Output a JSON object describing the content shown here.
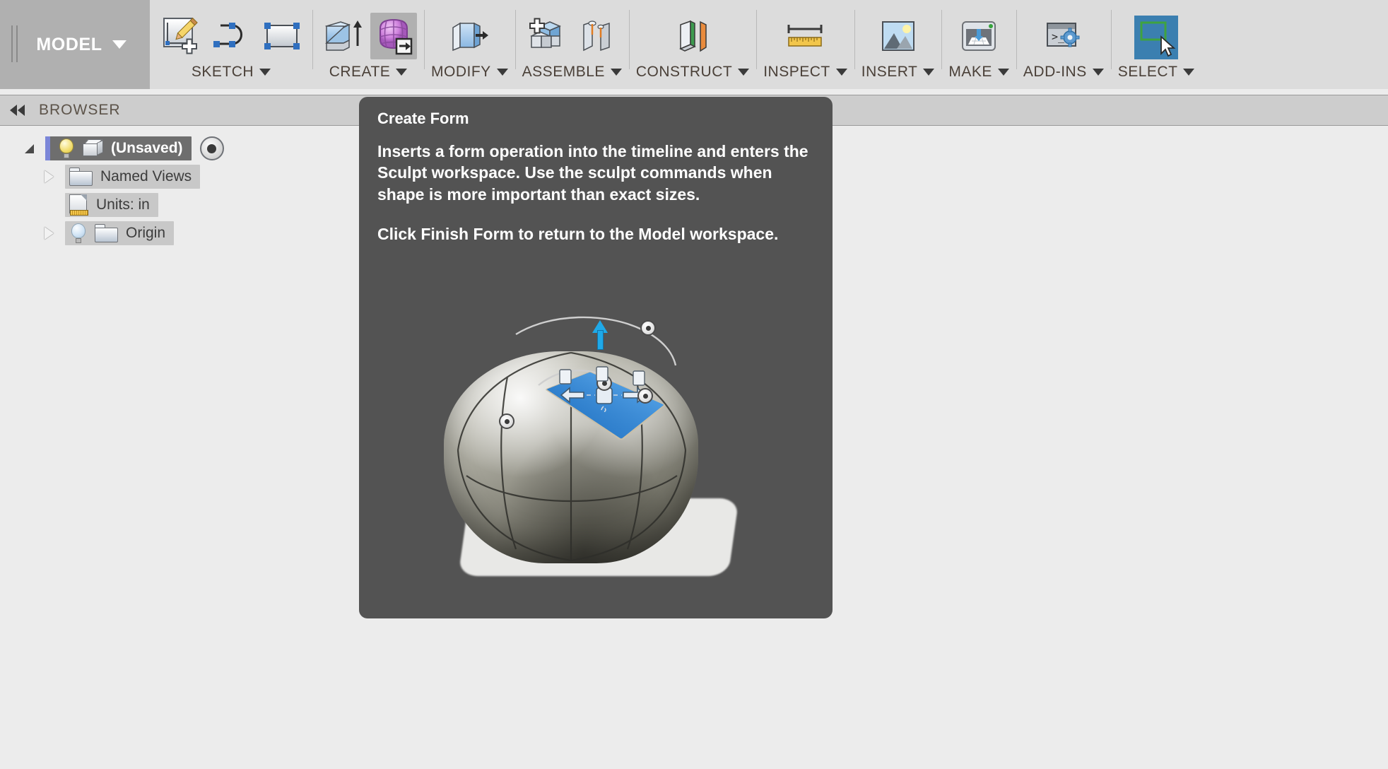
{
  "ribbon": {
    "workspace": {
      "label": "MODEL",
      "icon": "chevron-down-icon"
    },
    "panels": [
      {
        "id": "sketch",
        "label": "SKETCH",
        "tools": [
          {
            "name": "create-sketch-icon",
            "active": false
          },
          {
            "name": "spline-icon",
            "active": false
          },
          {
            "name": "rectangle-icon",
            "active": false
          }
        ]
      },
      {
        "id": "create",
        "label": "CREATE",
        "tools": [
          {
            "name": "extrude-icon",
            "active": false
          },
          {
            "name": "create-form-icon",
            "active": true
          }
        ]
      },
      {
        "id": "modify",
        "label": "MODIFY",
        "tools": [
          {
            "name": "press-pull-icon",
            "active": false
          }
        ]
      },
      {
        "id": "assemble",
        "label": "ASSEMBLE",
        "tools": [
          {
            "name": "new-component-icon",
            "active": false
          },
          {
            "name": "joint-icon",
            "active": false
          }
        ]
      },
      {
        "id": "construct",
        "label": "CONSTRUCT",
        "tools": [
          {
            "name": "offset-plane-icon",
            "active": false
          }
        ]
      },
      {
        "id": "inspect",
        "label": "INSPECT",
        "tools": [
          {
            "name": "measure-icon",
            "active": false
          }
        ]
      },
      {
        "id": "insert",
        "label": "INSERT",
        "tools": [
          {
            "name": "insert-image-icon",
            "active": false
          }
        ]
      },
      {
        "id": "make",
        "label": "MAKE",
        "tools": [
          {
            "name": "3d-print-icon",
            "active": false
          }
        ]
      },
      {
        "id": "addins",
        "label": "ADD-INS",
        "tools": [
          {
            "name": "scripts-addins-icon",
            "active": false
          }
        ]
      },
      {
        "id": "select",
        "label": "SELECT",
        "tools": [
          {
            "name": "select-icon",
            "active": true
          }
        ]
      }
    ]
  },
  "browser": {
    "collapse_icon": "double-chevron-left-icon",
    "title": "BROWSER",
    "tree": [
      {
        "label": "(Unsaved)",
        "level": 0,
        "twisty": "open",
        "selected": true,
        "icons": [
          "lightbulb-on-icon",
          "component-cube-icon"
        ],
        "trailing_icon": "radio-target-icon"
      },
      {
        "label": "Named Views",
        "level": 1,
        "twisty": "closed",
        "selected": false,
        "icons": [
          "folder-icon"
        ],
        "trailing_icon": ""
      },
      {
        "label": "Units: in",
        "level": 1,
        "twisty": "none",
        "selected": false,
        "icons": [
          "units-document-icon"
        ],
        "trailing_icon": ""
      },
      {
        "label": "Origin",
        "level": 1,
        "twisty": "closed",
        "selected": false,
        "icons": [
          "lightbulb-off-icon",
          "folder-icon"
        ],
        "trailing_icon": ""
      }
    ]
  },
  "tooltip": {
    "title": "Create Form",
    "paragraphs": [
      "Inserts a form operation into the timeline and enters the Sculpt workspace. Use the sculpt commands when shape is more important than exact sizes.",
      "Click Finish Form to return to the Model workspace."
    ],
    "illustration": "sculpt-form-rounded-cube-illustration"
  },
  "colors": {
    "ribbon_bg": "#dcdcdc",
    "workspace_bg": "#b0b0b0",
    "canvas_bg": "#ececec",
    "tooltip_bg": "#535353",
    "selection_blue": "#3b86cd",
    "select_tool_bg": "#3b7fb0",
    "label_text": "#4a4038"
  }
}
